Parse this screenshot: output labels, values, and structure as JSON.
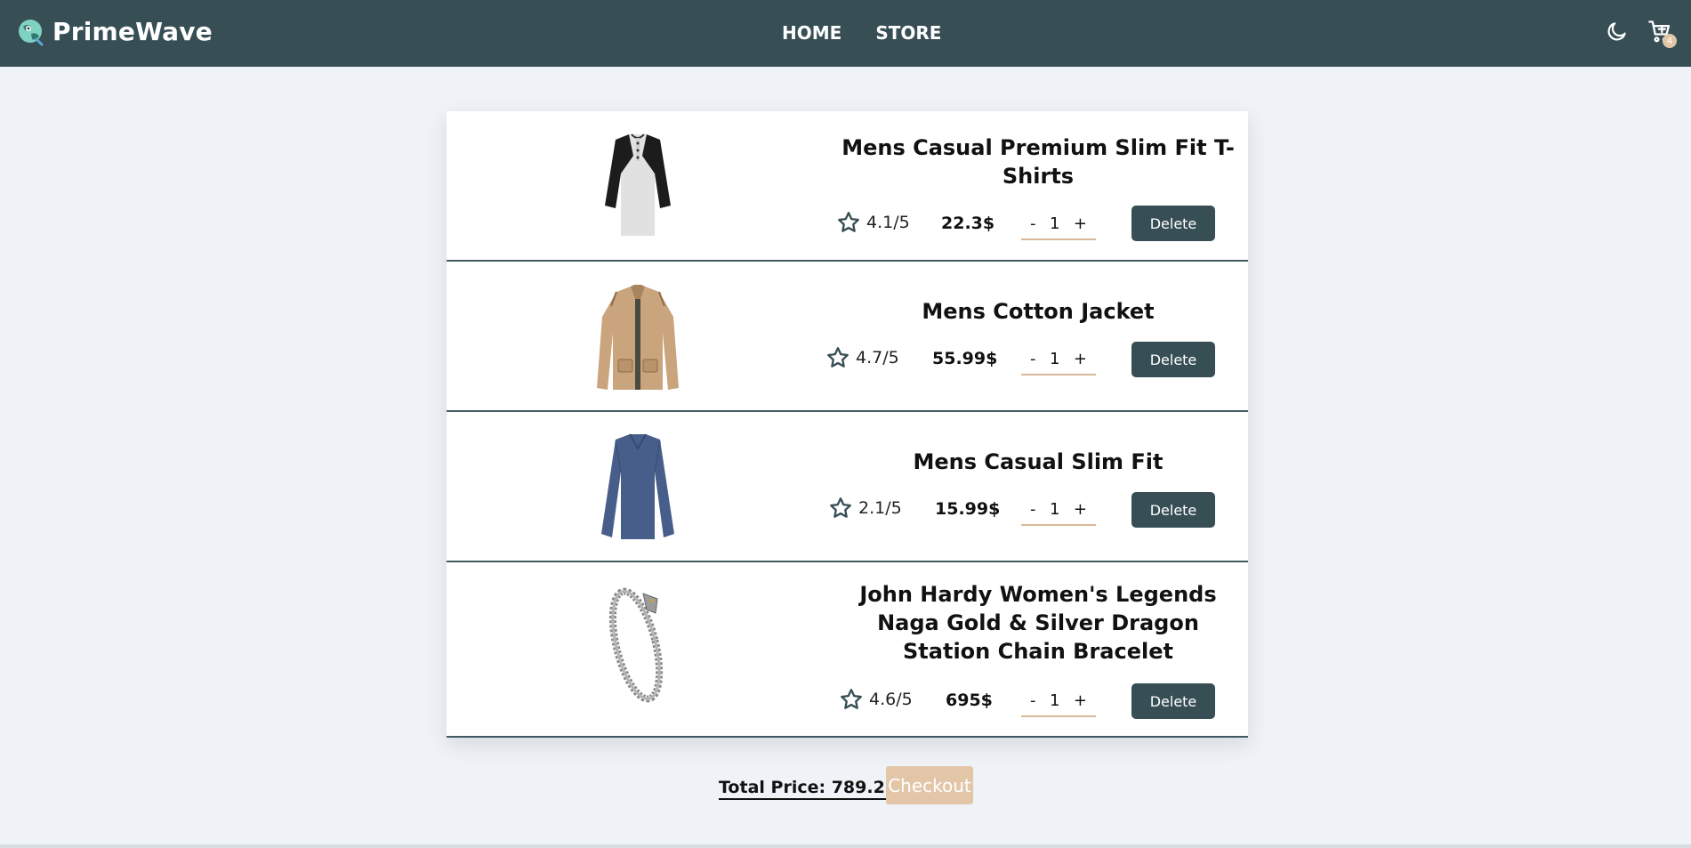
{
  "brand": {
    "name": "PrimeWave"
  },
  "nav": {
    "links": [
      "HOME",
      "STORE"
    ]
  },
  "cart": {
    "badge_count": "4"
  },
  "items": [
    {
      "title": "Mens Casual Premium Slim Fit T-Shirts",
      "rating": "4.1/5",
      "price": "22.3$",
      "quantity": "1",
      "delete_label": "Delete",
      "image": "raglan-henley-shirt"
    },
    {
      "title": "Mens Cotton Jacket",
      "rating": "4.7/5",
      "price": "55.99$",
      "quantity": "1",
      "delete_label": "Delete",
      "image": "khaki-cotton-jacket"
    },
    {
      "title": "Mens Casual Slim Fit",
      "rating": "2.1/5",
      "price": "15.99$",
      "quantity": "1",
      "delete_label": "Delete",
      "image": "blue-long-sleeve-shirt"
    },
    {
      "title": "John Hardy Women's Legends Naga Gold & Silver Dragon Station Chain Bracelet",
      "rating": "4.6/5",
      "price": "695$",
      "quantity": "1",
      "delete_label": "Delete",
      "image": "silver-dragon-bracelet"
    }
  ],
  "qty_controls": {
    "minus": "-",
    "plus": "+"
  },
  "footer": {
    "total_label": "Total Price: 789.28",
    "checkout_label": "Checkout"
  },
  "colors": {
    "navbar": "#374e55",
    "accent": "#e3c6a8",
    "background": "#eff2f7"
  }
}
